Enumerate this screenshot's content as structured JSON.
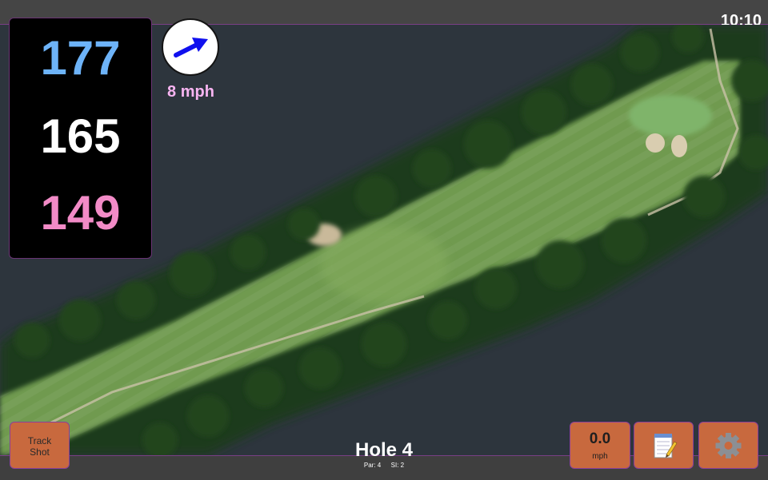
{
  "status": {
    "time": "10:10"
  },
  "distances": {
    "back": "177",
    "middle": "165",
    "front": "149"
  },
  "wind": {
    "speed": "8 mph",
    "arrow_icon": "wind-direction-arrow-icon",
    "arrow_color": "#1010ee"
  },
  "hole": {
    "title": "Hole 4",
    "par": "Par: 4",
    "si": "SI: 2"
  },
  "buttons": {
    "track_shot": {
      "line1": "Track",
      "line2": "Shot"
    },
    "speed": {
      "value": "0.0",
      "unit": "mph"
    },
    "notes": {
      "icon": "notepad-icon"
    },
    "settings": {
      "icon": "gear-icon"
    }
  },
  "colors": {
    "button": "#c8693e",
    "back_distance": "#6db3f8",
    "front_distance": "#f28bc7",
    "wind_text": "#f7b4f1",
    "accent_border": "#7a3f86"
  }
}
